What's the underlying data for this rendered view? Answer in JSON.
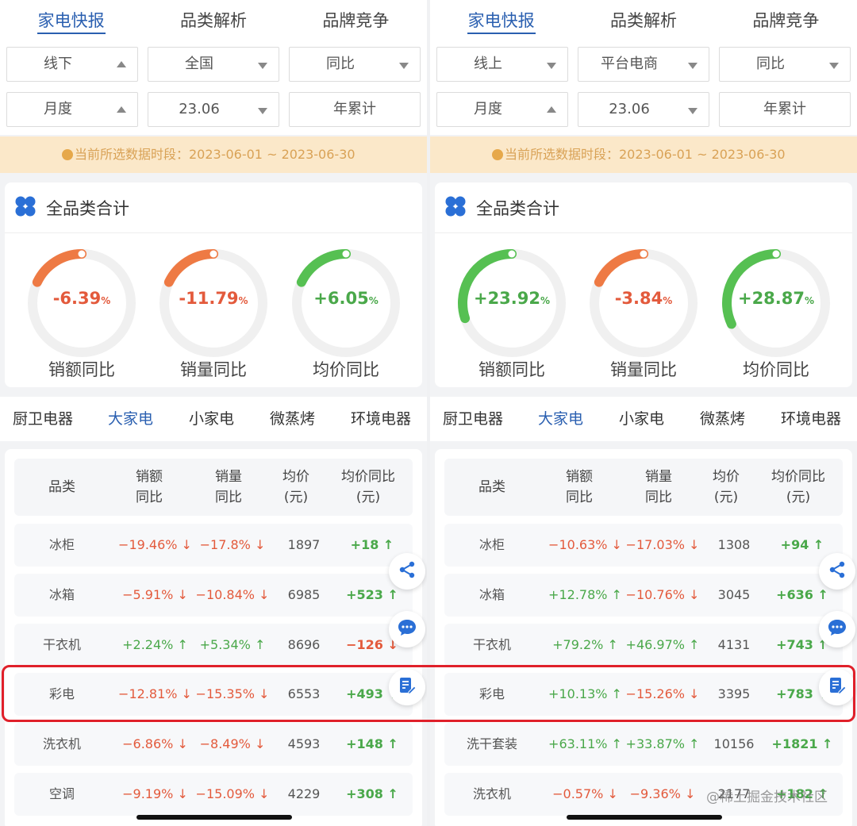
{
  "colors": {
    "accent": "#2a5fb0",
    "negative": "#e35a3c",
    "positive": "#4aa84a",
    "banner_bg": "#fbe8c9",
    "highlight": "#e0202a"
  },
  "panels": [
    {
      "tabs": [
        "家电快报",
        "品类解析",
        "品牌竞争"
      ],
      "filters": [
        {
          "value": "线下",
          "caret": "up"
        },
        {
          "value": "全国",
          "caret": "down"
        },
        {
          "value": "同比",
          "caret": "down"
        },
        {
          "value": "月度",
          "caret": "up"
        },
        {
          "value": "23.06",
          "caret": "down"
        },
        {
          "value": "年累计",
          "caret": "none"
        }
      ],
      "banner": "当前所选数据时段：2023-06-01 ~ 2023-06-30",
      "card_title": "全品类合计",
      "gauges": [
        {
          "value": "-6.39",
          "unit": "%",
          "label": "销额同比",
          "fraction": 0.18,
          "positive": false
        },
        {
          "value": "-11.79",
          "unit": "%",
          "label": "销量同比",
          "fraction": 0.18,
          "positive": false
        },
        {
          "value": "+6.05",
          "unit": "%",
          "label": "均价同比",
          "fraction": 0.18,
          "positive": true
        }
      ],
      "categories": [
        "厨卫电器",
        "大家电",
        "小家电",
        "微蒸烤",
        "环境电器"
      ],
      "active_category": 1,
      "headers": [
        "品类",
        "销额\n同比",
        "销量\n同比",
        "均价\n(元)",
        "均价同比\n(元)"
      ],
      "rows": [
        {
          "name": "冰柜",
          "sales": "−19.46% ↓",
          "sales_up": false,
          "vol": "−17.8% ↓",
          "vol_up": false,
          "price": "1897",
          "delta": "+18 ↑",
          "delta_up": true
        },
        {
          "name": "冰箱",
          "sales": "−5.91% ↓",
          "sales_up": false,
          "vol": "−10.84% ↓",
          "vol_up": false,
          "price": "6985",
          "delta": "+523 ↑",
          "delta_up": true
        },
        {
          "name": "干衣机",
          "sales": "+2.24% ↑",
          "sales_up": true,
          "vol": "+5.34% ↑",
          "vol_up": true,
          "price": "8696",
          "delta": "−126 ↓",
          "delta_up": false
        },
        {
          "name": "彩电",
          "sales": "−12.81% ↓",
          "sales_up": false,
          "vol": "−15.35% ↓",
          "vol_up": false,
          "price": "6553",
          "delta": "+493 ↑",
          "delta_up": true
        },
        {
          "name": "洗衣机",
          "sales": "−6.86% ↓",
          "sales_up": false,
          "vol": "−8.49% ↓",
          "vol_up": false,
          "price": "4593",
          "delta": "+148 ↑",
          "delta_up": true
        },
        {
          "name": "空调",
          "sales": "−9.19% ↓",
          "sales_up": false,
          "vol": "−15.09% ↓",
          "vol_up": false,
          "price": "4229",
          "delta": "+308 ↑",
          "delta_up": true
        }
      ],
      "fab_icons": [
        "share-icon",
        "chat-icon",
        "edit-note-icon"
      ]
    },
    {
      "tabs": [
        "家电快报",
        "品类解析",
        "品牌竞争"
      ],
      "filters": [
        {
          "value": "线上",
          "caret": "down"
        },
        {
          "value": "平台电商",
          "caret": "down"
        },
        {
          "value": "同比",
          "caret": "down"
        },
        {
          "value": "月度",
          "caret": "up"
        },
        {
          "value": "23.06",
          "caret": "down"
        },
        {
          "value": "年累计",
          "caret": "none"
        }
      ],
      "banner": "当前所选数据时段：2023-06-01 ~ 2023-06-30",
      "card_title": "全品类合计",
      "gauges": [
        {
          "value": "+23.92",
          "unit": "%",
          "label": "销额同比",
          "fraction": 0.3,
          "positive": true
        },
        {
          "value": "-3.84",
          "unit": "%",
          "label": "销量同比",
          "fraction": 0.18,
          "positive": false
        },
        {
          "value": "+28.87",
          "unit": "%",
          "label": "均价同比",
          "fraction": 0.32,
          "positive": true
        }
      ],
      "categories": [
        "厨卫电器",
        "大家电",
        "小家电",
        "微蒸烤",
        "环境电器"
      ],
      "active_category": 1,
      "headers": [
        "品类",
        "销额\n同比",
        "销量\n同比",
        "均价\n(元)",
        "均价同比\n(元)"
      ],
      "rows": [
        {
          "name": "冰柜",
          "sales": "−10.63% ↓",
          "sales_up": false,
          "vol": "−17.03% ↓",
          "vol_up": false,
          "price": "1308",
          "delta": "+94 ↑",
          "delta_up": true
        },
        {
          "name": "冰箱",
          "sales": "+12.78% ↑",
          "sales_up": true,
          "vol": "−10.76% ↓",
          "vol_up": false,
          "price": "3045",
          "delta": "+636 ↑",
          "delta_up": true
        },
        {
          "name": "干衣机",
          "sales": "+79.2% ↑",
          "sales_up": true,
          "vol": "+46.97% ↑",
          "vol_up": true,
          "price": "4131",
          "delta": "+743 ↑",
          "delta_up": true
        },
        {
          "name": "彩电",
          "sales": "+10.13% ↑",
          "sales_up": true,
          "vol": "−15.26% ↓",
          "vol_up": false,
          "price": "3395",
          "delta": "+783 ↑",
          "delta_up": true
        },
        {
          "name": "洗干套装",
          "sales": "+63.11% ↑",
          "sales_up": true,
          "vol": "+33.87% ↑",
          "vol_up": true,
          "price": "10156",
          "delta": "+1821 ↑",
          "delta_up": true
        },
        {
          "name": "洗衣机",
          "sales": "−0.57% ↓",
          "sales_up": false,
          "vol": "−9.36% ↓",
          "vol_up": false,
          "price": "2177",
          "delta": "+182 ↑",
          "delta_up": true
        }
      ],
      "fab_icons": [
        "share-icon",
        "chat-icon",
        "edit-note-icon"
      ]
    }
  ],
  "watermark": "@稀土掘金技术社区"
}
